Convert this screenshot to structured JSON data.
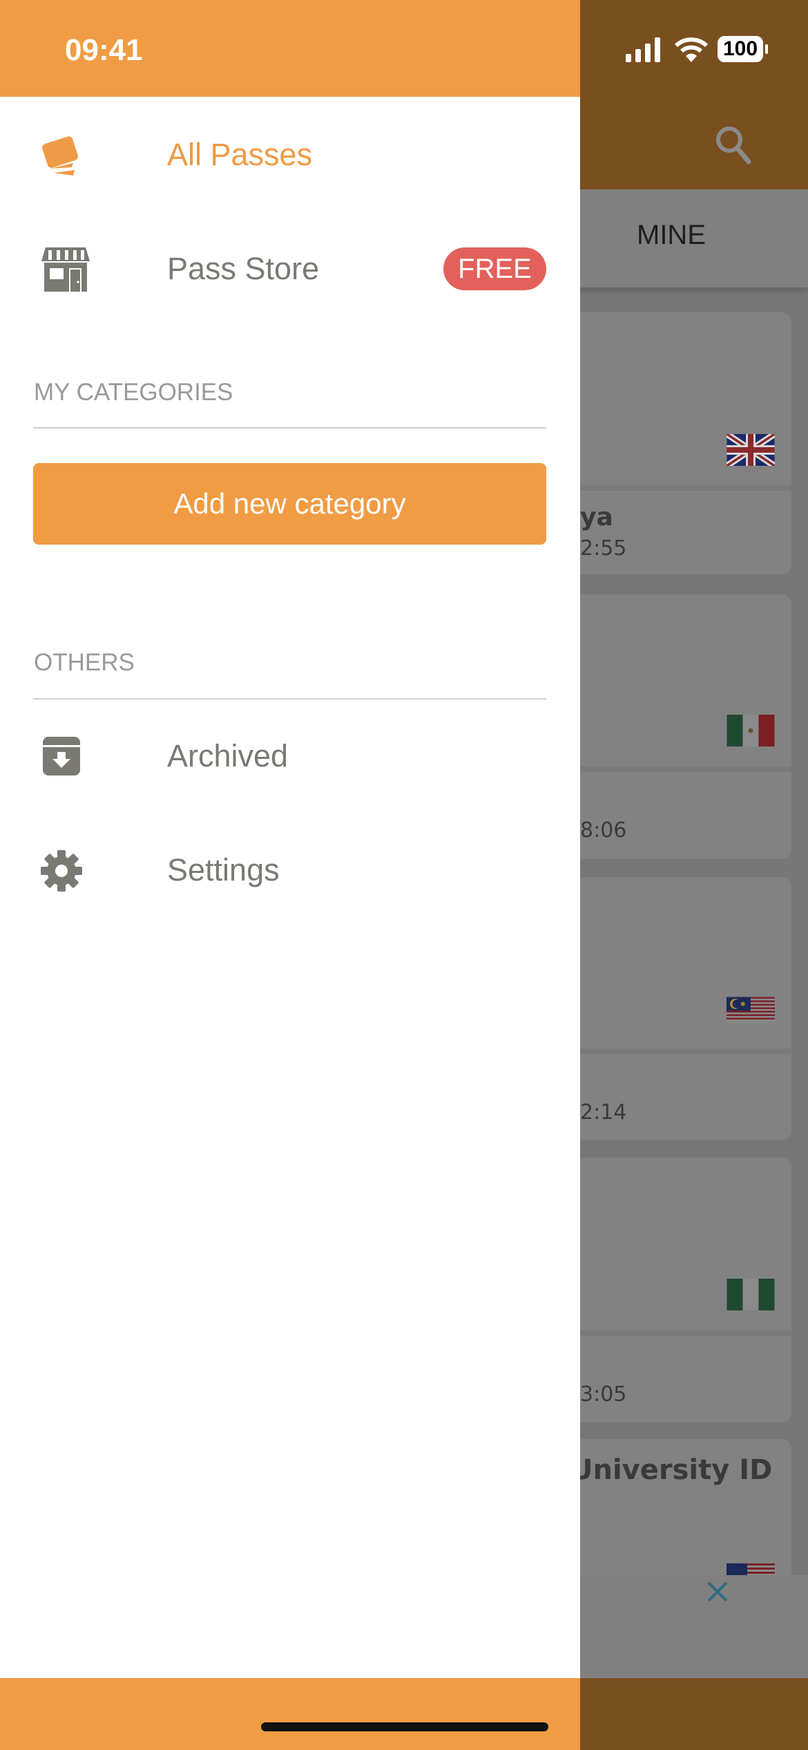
{
  "status_bar": {
    "time": "09:41",
    "battery": "100"
  },
  "drawer": {
    "items": [
      {
        "label": "All Passes",
        "icon": "cards-icon",
        "active": true
      },
      {
        "label": "Pass Store",
        "icon": "store-icon",
        "badge": "FREE"
      }
    ],
    "my_categories": {
      "title": "MY CATEGORIES",
      "add_button": "Add new category"
    },
    "others": {
      "title": "OTHERS",
      "items": [
        {
          "label": "Archived",
          "icon": "archive-icon"
        },
        {
          "label": "Settings",
          "icon": "gear-icon"
        }
      ]
    }
  },
  "background": {
    "tab": "MINE",
    "cards": [
      {
        "flag": "uk",
        "title_fragment": "ya",
        "time_fragment": "2:55"
      },
      {
        "flag": "mexico",
        "time_fragment": "8:06"
      },
      {
        "flag": "malaysia",
        "time_fragment": "2:14"
      },
      {
        "flag": "nigeria",
        "time_fragment": "3:05"
      },
      {
        "flag": "usa",
        "title_fragment": "University ID"
      }
    ]
  },
  "colors": {
    "accent": "#f09c44",
    "badge": "#e2615a",
    "header_dimmed": "#7a4f20"
  }
}
